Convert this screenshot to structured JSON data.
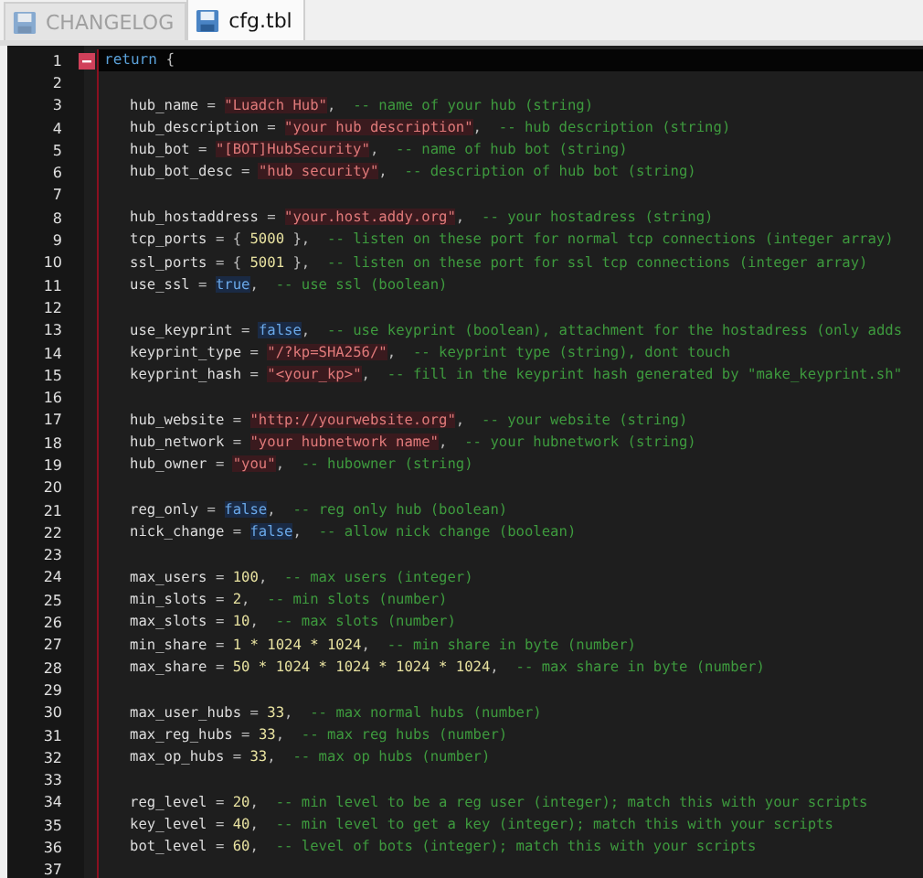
{
  "tabs": [
    {
      "label": "CHANGELOG",
      "selected": false
    },
    {
      "label": "cfg.tbl",
      "selected": true
    }
  ],
  "editor": {
    "lines": [
      {
        "number": "1",
        "kind": "block-start",
        "current": true,
        "tokens": [
          {
            "kind": "keyword",
            "text": "return"
          },
          {
            "kind": "punct",
            "text": " {"
          }
        ]
      },
      {
        "number": "2",
        "kind": "blank",
        "current": false
      },
      {
        "number": "3",
        "kind": "field",
        "current": false,
        "tokens": [
          {
            "kind": "key",
            "text": "hub_name"
          },
          {
            "kind": "punct",
            "text": " = "
          },
          {
            "kind": "string",
            "text": "\"Luadch Hub\""
          },
          {
            "kind": "punct",
            "text": ",  "
          },
          {
            "kind": "comment",
            "text": "-- name of your hub (string)"
          }
        ]
      },
      {
        "number": "4",
        "kind": "field",
        "current": false,
        "tokens": [
          {
            "kind": "key",
            "text": "hub_description"
          },
          {
            "kind": "punct",
            "text": " = "
          },
          {
            "kind": "string",
            "text": "\"your hub description\""
          },
          {
            "kind": "punct",
            "text": ",  "
          },
          {
            "kind": "comment",
            "text": "-- hub description (string)"
          }
        ]
      },
      {
        "number": "5",
        "kind": "field",
        "current": false,
        "tokens": [
          {
            "kind": "key",
            "text": "hub_bot"
          },
          {
            "kind": "punct",
            "text": " = "
          },
          {
            "kind": "string",
            "text": "\"[BOT]HubSecurity\""
          },
          {
            "kind": "punct",
            "text": ",  "
          },
          {
            "kind": "comment",
            "text": "-- name of hub bot (string)"
          }
        ]
      },
      {
        "number": "6",
        "kind": "field",
        "current": false,
        "tokens": [
          {
            "kind": "key",
            "text": "hub_bot_desc"
          },
          {
            "kind": "punct",
            "text": " = "
          },
          {
            "kind": "string",
            "text": "\"hub security\""
          },
          {
            "kind": "punct",
            "text": ",  "
          },
          {
            "kind": "comment",
            "text": "-- description of hub bot (string)"
          }
        ]
      },
      {
        "number": "7",
        "kind": "blank",
        "current": false
      },
      {
        "number": "8",
        "kind": "field",
        "current": false,
        "tokens": [
          {
            "kind": "key",
            "text": "hub_hostaddress"
          },
          {
            "kind": "punct",
            "text": " = "
          },
          {
            "kind": "string",
            "text": "\"your.host.addy.org\""
          },
          {
            "kind": "punct",
            "text": ",  "
          },
          {
            "kind": "comment",
            "text": "-- your hostadress (string)"
          }
        ]
      },
      {
        "number": "9",
        "kind": "field",
        "current": false,
        "tokens": [
          {
            "kind": "key",
            "text": "tcp_ports"
          },
          {
            "kind": "punct",
            "text": " = { "
          },
          {
            "kind": "number",
            "text": "5000"
          },
          {
            "kind": "punct",
            "text": " },  "
          },
          {
            "kind": "comment",
            "text": "-- listen on these port for normal tcp connections (integer array)"
          }
        ]
      },
      {
        "number": "10",
        "kind": "field",
        "current": false,
        "tokens": [
          {
            "kind": "key",
            "text": "ssl_ports"
          },
          {
            "kind": "punct",
            "text": " = { "
          },
          {
            "kind": "number",
            "text": "5001"
          },
          {
            "kind": "punct",
            "text": " },  "
          },
          {
            "kind": "comment",
            "text": "-- listen on these port for ssl tcp connections (integer array)"
          }
        ]
      },
      {
        "number": "11",
        "kind": "field",
        "current": false,
        "tokens": [
          {
            "kind": "key",
            "text": "use_ssl"
          },
          {
            "kind": "punct",
            "text": " = "
          },
          {
            "kind": "bool",
            "text": "true"
          },
          {
            "kind": "punct",
            "text": ",  "
          },
          {
            "kind": "comment",
            "text": "-- use ssl (boolean)"
          }
        ]
      },
      {
        "number": "12",
        "kind": "blank",
        "current": false
      },
      {
        "number": "13",
        "kind": "field",
        "current": false,
        "tokens": [
          {
            "kind": "key",
            "text": "use_keyprint"
          },
          {
            "kind": "punct",
            "text": " = "
          },
          {
            "kind": "bool",
            "text": "false"
          },
          {
            "kind": "punct",
            "text": ",  "
          },
          {
            "kind": "comment",
            "text": "-- use keyprint (boolean), attachment for the hostadress (only adds"
          }
        ]
      },
      {
        "number": "14",
        "kind": "field",
        "current": false,
        "tokens": [
          {
            "kind": "key",
            "text": "keyprint_type"
          },
          {
            "kind": "punct",
            "text": " = "
          },
          {
            "kind": "string",
            "text": "\"/?kp=SHA256/\""
          },
          {
            "kind": "punct",
            "text": ",  "
          },
          {
            "kind": "comment",
            "text": "-- keyprint type (string), dont touch"
          }
        ]
      },
      {
        "number": "15",
        "kind": "field",
        "current": false,
        "tokens": [
          {
            "kind": "key",
            "text": "keyprint_hash"
          },
          {
            "kind": "punct",
            "text": " = "
          },
          {
            "kind": "string",
            "text": "\"<your_kp>\""
          },
          {
            "kind": "punct",
            "text": ",  "
          },
          {
            "kind": "comment",
            "text": "-- fill in the keyprint hash generated by \"make_keyprint.sh\""
          }
        ]
      },
      {
        "number": "16",
        "kind": "blank",
        "current": false
      },
      {
        "number": "17",
        "kind": "field",
        "current": false,
        "tokens": [
          {
            "kind": "key",
            "text": "hub_website"
          },
          {
            "kind": "punct",
            "text": " = "
          },
          {
            "kind": "string",
            "text": "\"http://yourwebsite.org\""
          },
          {
            "kind": "punct",
            "text": ",  "
          },
          {
            "kind": "comment",
            "text": "-- your website (string)"
          }
        ]
      },
      {
        "number": "18",
        "kind": "field",
        "current": false,
        "tokens": [
          {
            "kind": "key",
            "text": "hub_network"
          },
          {
            "kind": "punct",
            "text": " = "
          },
          {
            "kind": "string",
            "text": "\"your hubnetwork name\""
          },
          {
            "kind": "punct",
            "text": ",  "
          },
          {
            "kind": "comment",
            "text": "-- your hubnetwork (string)"
          }
        ]
      },
      {
        "number": "19",
        "kind": "field",
        "current": false,
        "tokens": [
          {
            "kind": "key",
            "text": "hub_owner"
          },
          {
            "kind": "punct",
            "text": " = "
          },
          {
            "kind": "string",
            "text": "\"you\""
          },
          {
            "kind": "punct",
            "text": ",  "
          },
          {
            "kind": "comment",
            "text": "-- hubowner (string)"
          }
        ]
      },
      {
        "number": "20",
        "kind": "blank",
        "current": false
      },
      {
        "number": "21",
        "kind": "field",
        "current": false,
        "tokens": [
          {
            "kind": "key",
            "text": "reg_only"
          },
          {
            "kind": "punct",
            "text": " = "
          },
          {
            "kind": "bool",
            "text": "false"
          },
          {
            "kind": "punct",
            "text": ",  "
          },
          {
            "kind": "comment",
            "text": "-- reg only hub (boolean)"
          }
        ]
      },
      {
        "number": "22",
        "kind": "field",
        "current": false,
        "tokens": [
          {
            "kind": "key",
            "text": "nick_change"
          },
          {
            "kind": "punct",
            "text": " = "
          },
          {
            "kind": "bool",
            "text": "false"
          },
          {
            "kind": "punct",
            "text": ",  "
          },
          {
            "kind": "comment",
            "text": "-- allow nick change (boolean)"
          }
        ]
      },
      {
        "number": "23",
        "kind": "blank",
        "current": false
      },
      {
        "number": "24",
        "kind": "field",
        "current": false,
        "tokens": [
          {
            "kind": "key",
            "text": "max_users"
          },
          {
            "kind": "punct",
            "text": " = "
          },
          {
            "kind": "number",
            "text": "100"
          },
          {
            "kind": "punct",
            "text": ",  "
          },
          {
            "kind": "comment",
            "text": "-- max users (integer)"
          }
        ]
      },
      {
        "number": "25",
        "kind": "field",
        "current": false,
        "tokens": [
          {
            "kind": "key",
            "text": "min_slots"
          },
          {
            "kind": "punct",
            "text": " = "
          },
          {
            "kind": "number",
            "text": "2"
          },
          {
            "kind": "punct",
            "text": ",  "
          },
          {
            "kind": "comment",
            "text": "-- min slots (number)"
          }
        ]
      },
      {
        "number": "26",
        "kind": "field",
        "current": false,
        "tokens": [
          {
            "kind": "key",
            "text": "max_slots"
          },
          {
            "kind": "punct",
            "text": " = "
          },
          {
            "kind": "number",
            "text": "10"
          },
          {
            "kind": "punct",
            "text": ",  "
          },
          {
            "kind": "comment",
            "text": "-- max slots (number)"
          }
        ]
      },
      {
        "number": "27",
        "kind": "field",
        "current": false,
        "tokens": [
          {
            "kind": "key",
            "text": "min_share"
          },
          {
            "kind": "punct",
            "text": " = "
          },
          {
            "kind": "number",
            "text": "1 * 1024 * 1024"
          },
          {
            "kind": "punct",
            "text": ",  "
          },
          {
            "kind": "comment",
            "text": "-- min share in byte (number)"
          }
        ]
      },
      {
        "number": "28",
        "kind": "field",
        "current": false,
        "tokens": [
          {
            "kind": "key",
            "text": "max_share"
          },
          {
            "kind": "punct",
            "text": " = "
          },
          {
            "kind": "number",
            "text": "50 * 1024 * 1024 * 1024 * 1024"
          },
          {
            "kind": "punct",
            "text": ",  "
          },
          {
            "kind": "comment",
            "text": "-- max share in byte (number)"
          }
        ]
      },
      {
        "number": "29",
        "kind": "blank",
        "current": false
      },
      {
        "number": "30",
        "kind": "field",
        "current": false,
        "tokens": [
          {
            "kind": "key",
            "text": "max_user_hubs"
          },
          {
            "kind": "punct",
            "text": " = "
          },
          {
            "kind": "number",
            "text": "33"
          },
          {
            "kind": "punct",
            "text": ",  "
          },
          {
            "kind": "comment",
            "text": "-- max normal hubs (number)"
          }
        ]
      },
      {
        "number": "31",
        "kind": "field",
        "current": false,
        "tokens": [
          {
            "kind": "key",
            "text": "max_reg_hubs"
          },
          {
            "kind": "punct",
            "text": " = "
          },
          {
            "kind": "number",
            "text": "33"
          },
          {
            "kind": "punct",
            "text": ",  "
          },
          {
            "kind": "comment",
            "text": "-- max reg hubs (number)"
          }
        ]
      },
      {
        "number": "32",
        "kind": "field",
        "current": false,
        "tokens": [
          {
            "kind": "key",
            "text": "max_op_hubs"
          },
          {
            "kind": "punct",
            "text": " = "
          },
          {
            "kind": "number",
            "text": "33"
          },
          {
            "kind": "punct",
            "text": ",  "
          },
          {
            "kind": "comment",
            "text": "-- max op hubs (number)"
          }
        ]
      },
      {
        "number": "33",
        "kind": "blank",
        "current": false
      },
      {
        "number": "34",
        "kind": "field",
        "current": false,
        "tokens": [
          {
            "kind": "key",
            "text": "reg_level"
          },
          {
            "kind": "punct",
            "text": " = "
          },
          {
            "kind": "number",
            "text": "20"
          },
          {
            "kind": "punct",
            "text": ",  "
          },
          {
            "kind": "comment",
            "text": "-- min level to be a reg user (integer); match this with your scripts"
          }
        ]
      },
      {
        "number": "35",
        "kind": "field",
        "current": false,
        "tokens": [
          {
            "kind": "key",
            "text": "key_level"
          },
          {
            "kind": "punct",
            "text": " = "
          },
          {
            "kind": "number",
            "text": "40"
          },
          {
            "kind": "punct",
            "text": ",  "
          },
          {
            "kind": "comment",
            "text": "-- min level to get a key (integer); match this with your scripts"
          }
        ]
      },
      {
        "number": "36",
        "kind": "field",
        "current": false,
        "tokens": [
          {
            "kind": "key",
            "text": "bot_level"
          },
          {
            "kind": "punct",
            "text": " = "
          },
          {
            "kind": "number",
            "text": "60"
          },
          {
            "kind": "punct",
            "text": ",  "
          },
          {
            "kind": "comment",
            "text": "-- level of bots (integer); match this with your scripts"
          }
        ]
      },
      {
        "number": "37",
        "kind": "blank",
        "current": false
      }
    ]
  }
}
